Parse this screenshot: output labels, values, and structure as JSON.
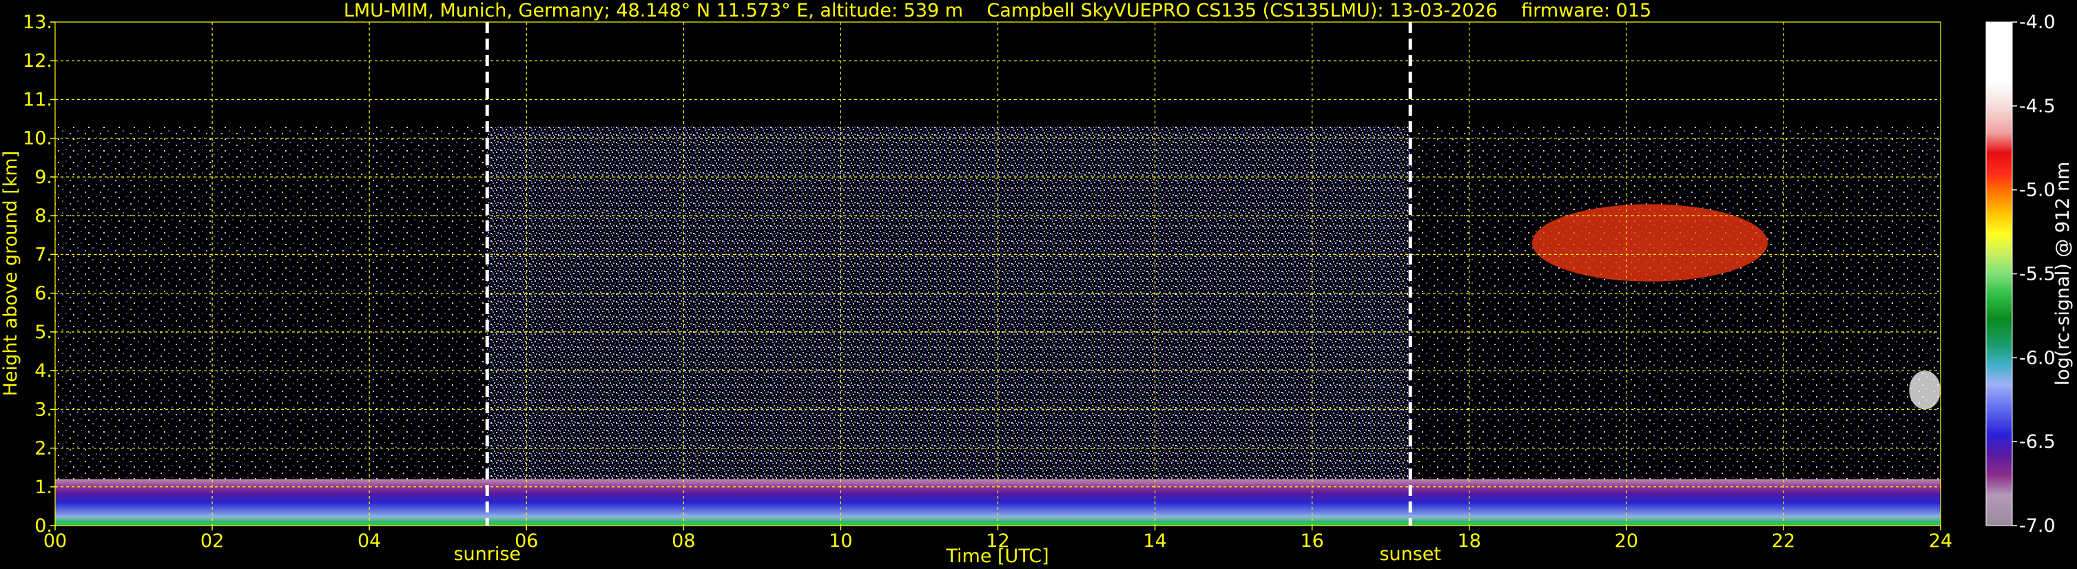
{
  "chart_data": {
    "type": "heatmap",
    "title": "LMU-MIM, Munich, Germany; 48.148° N 11.573° E, altitude: 539 m    Campbell SkyVUEPRO CS135 (CS135LMU): 13-03-2026    firmware: 015",
    "xlabel": "Time [UTC]",
    "ylabel": "Height above ground [km]",
    "xlim": [
      0,
      24
    ],
    "ylim": [
      0,
      13
    ],
    "x_ticks": [
      "00",
      "02",
      "04",
      "06",
      "08",
      "10",
      "12",
      "14",
      "16",
      "18",
      "20",
      "22",
      "24"
    ],
    "y_ticks": [
      "0.",
      "1.",
      "2.",
      "3.",
      "4.",
      "5.",
      "6.",
      "7.",
      "8.",
      "9.",
      "10.",
      "11.",
      "12.",
      "13."
    ],
    "grid": true,
    "grid_color": "#ffff00",
    "text_color": "#ffff00",
    "background": "#000000",
    "markers": [
      {
        "label": "sunrise",
        "x": 5.5
      },
      {
        "label": "sunset",
        "x": 17.25
      }
    ],
    "colorbar": {
      "label": "log(rc-signal) @ 912 nm",
      "range": [
        -7.0,
        -4.0
      ],
      "ticks": [
        "-4.0",
        "-4.5",
        "-5.0",
        "-5.5",
        "-6.0",
        "-6.5",
        "-7.0"
      ]
    },
    "features": [
      {
        "name": "boundary layer aerosol",
        "x_start": 0,
        "x_end": 24,
        "height_km": [
          0.1,
          1.2
        ],
        "level": -6.5
      },
      {
        "name": "cirrus cloud",
        "x_start": 18.8,
        "x_end": 21.8,
        "height_km": [
          6.3,
          8.3
        ],
        "level": -5.0
      },
      {
        "name": "low cloud",
        "x_start": 23.6,
        "x_end": 24,
        "height_km": [
          3.0,
          4.0
        ],
        "level": -4.5
      }
    ]
  }
}
